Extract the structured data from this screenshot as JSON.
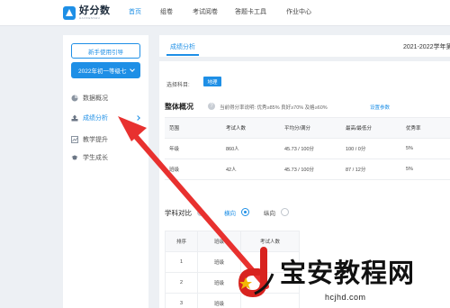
{
  "app": {
    "logo_name": "好分数",
    "logo_sub": "HAOFENSHU"
  },
  "nav": [
    {
      "label": "首页",
      "active": true
    },
    {
      "label": "组卷"
    },
    {
      "label": "考试阅卷"
    },
    {
      "label": "答题卡工具"
    },
    {
      "label": "作业中心"
    }
  ],
  "sidebar": {
    "guide_button": "新手使用引导",
    "year_select": "2022年初一等级七",
    "items": [
      {
        "label": "数据概况",
        "icon": "pie-chart-icon"
      },
      {
        "label": "成绩分析",
        "icon": "upload-icon",
        "active": true
      },
      {
        "label": "教学提升",
        "icon": "trend-chart-icon"
      },
      {
        "label": "学生成长",
        "icon": "graduation-cap-icon"
      }
    ]
  },
  "content": {
    "tab_active": "成绩分析",
    "term": "2021-2022学年第",
    "subject_label": "选择科目:",
    "subject_chip": "地理",
    "overview_title": "整体概况",
    "rate_note": "当前得分率说明: 优秀≥85% 良好≥70% 及格≥60%",
    "rate_link": "设置参数",
    "table": {
      "headers": [
        "范围",
        "考试人数",
        "平均分/满分",
        "最高/最低分",
        "优秀率"
      ],
      "rows": [
        [
          "年级",
          "860人",
          "45.73 / 100分",
          "100 / 0分",
          "5%"
        ],
        [
          "班级",
          "42人",
          "45.73 / 100分",
          "87 / 12分",
          "5%"
        ]
      ]
    },
    "compare_title": "学科对比",
    "compare_options": [
      "横向",
      "纵向"
    ],
    "compare_table": {
      "headers": [
        "排序",
        "班级",
        "考试人数"
      ],
      "rows": [
        [
          "1",
          "班级",
          ""
        ],
        [
          "2",
          "班级",
          ""
        ],
        [
          "3",
          "班级",
          ""
        ]
      ]
    }
  },
  "watermark": {
    "big": "宝安教程网",
    "url": "hcjhd.com"
  },
  "colors": {
    "accent": "#1e8fe6",
    "arrow": "#e8312f"
  }
}
